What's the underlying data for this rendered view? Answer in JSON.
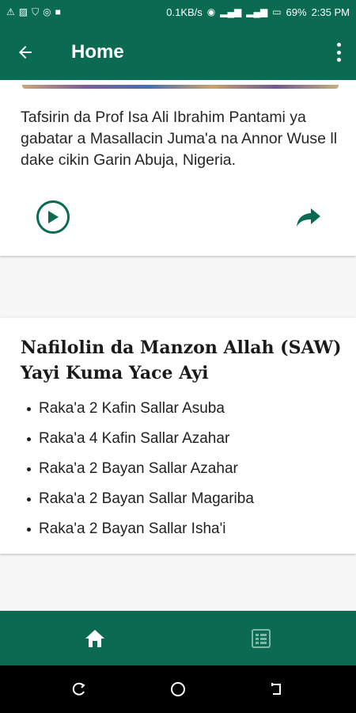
{
  "status_bar": {
    "network_speed": "0.1KB/s",
    "battery": "69%",
    "time": "2:35 PM",
    "left_icons": [
      "warning-icon",
      "image-icon",
      "shield-icon",
      "target-icon",
      "lock-icon"
    ],
    "right_icons": [
      "hotspot-icon",
      "signal-icon",
      "signal-icon",
      "battery-icon"
    ]
  },
  "app_bar": {
    "title": "Home",
    "back_icon": "arrow-left-icon",
    "menu_icon": "more-vert-icon"
  },
  "card1": {
    "description": "Tafsirin da Prof Isa Ali Ibrahim Pantami ya gabatar a Masallacin Juma'a na Annor Wuse ll dake cikin Garin Abuja, Nigeria.",
    "play_icon": "play-circle-icon",
    "share_icon": "share-icon"
  },
  "card2": {
    "heading": "Nafilolin da Manzon Allah (SAW) Yayi Kuma Yace Ayi",
    "items": [
      "Raka'a 2 Kafin Sallar Asuba",
      "Raka'a 4 Kafin Sallar Azahar",
      "Raka'a 2 Bayan Sallar Azahar",
      "Raka'a 2 Bayan Sallar Magariba",
      "Raka'a 2 Bayan Sallar Isha'i"
    ]
  },
  "bottom_nav": {
    "items": [
      "home-icon",
      "list-icon"
    ]
  },
  "colors": {
    "primary": "#0a6b52",
    "background": "#f7f7f7",
    "card": "#ffffff"
  }
}
